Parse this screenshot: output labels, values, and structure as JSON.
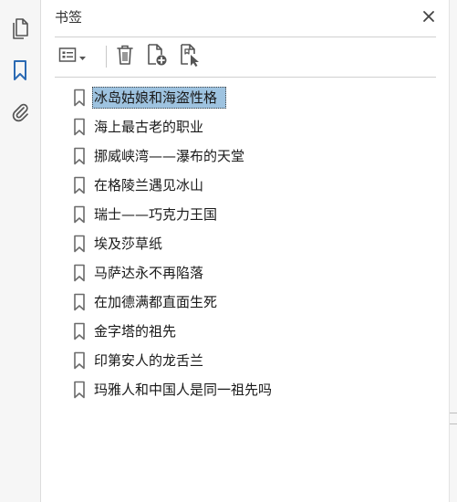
{
  "panel": {
    "title": "书签",
    "close_icon": "close-icon"
  },
  "rail": {
    "items": [
      {
        "name": "pages",
        "icon": "pages-icon",
        "active": false
      },
      {
        "name": "bookmarks",
        "icon": "bookmark-icon",
        "active": true
      },
      {
        "name": "attachments",
        "icon": "paperclip-icon",
        "active": false
      }
    ]
  },
  "toolbar": {
    "buttons": [
      {
        "name": "options-menu",
        "icon": "options-menu-icon",
        "has_dropdown": true
      },
      {
        "name": "delete-bookmark",
        "icon": "trash-icon"
      },
      {
        "name": "new-bookmark",
        "icon": "new-bookmark-icon"
      },
      {
        "name": "bookmark-from-selection",
        "icon": "bookmark-cursor-icon"
      }
    ]
  },
  "bookmarks": [
    {
      "label": "冰岛姑娘和海盗性格",
      "selected": true
    },
    {
      "label": "海上最古老的职业",
      "selected": false
    },
    {
      "label": "挪威峡湾——瀑布的天堂",
      "selected": false
    },
    {
      "label": "在格陵兰遇见冰山",
      "selected": false
    },
    {
      "label": "瑞士——巧克力王国",
      "selected": false
    },
    {
      "label": "埃及莎草纸",
      "selected": false
    },
    {
      "label": "马萨达永不再陷落",
      "selected": false
    },
    {
      "label": "在加德满都直面生死",
      "selected": false
    },
    {
      "label": "金字塔的祖先",
      "selected": false
    },
    {
      "label": "印第安人的龙舌兰",
      "selected": false
    },
    {
      "label": "玛雅人和中国人是同一祖先吗",
      "selected": false
    }
  ],
  "colors": {
    "accent": "#2b6ab3",
    "selection": "#9ec3e0",
    "icon": "#555555"
  }
}
